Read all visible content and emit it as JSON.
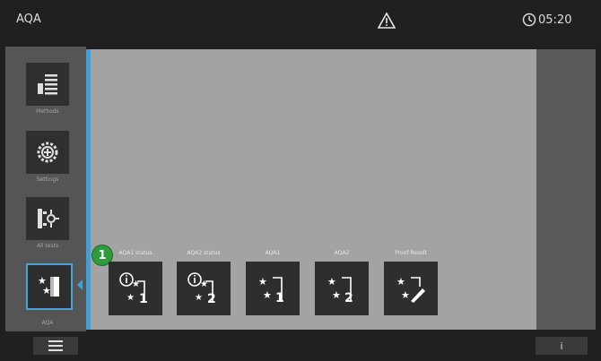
{
  "header": {
    "title": "AQA",
    "time": "05:20"
  },
  "sidebar": {
    "items": [
      {
        "label": "Methods",
        "icon": "methods-icon"
      },
      {
        "label": "Settings",
        "icon": "settings-icon"
      },
      {
        "label": "All tests",
        "icon": "all-tests-icon"
      },
      {
        "label": "AQA",
        "icon": "aqa-icon",
        "active": true
      }
    ]
  },
  "callout": {
    "number": "1"
  },
  "tiles": [
    {
      "label": "AQA1 status",
      "icon": "aqa1-status-icon"
    },
    {
      "label": "AQA2 status",
      "icon": "aqa2-status-icon"
    },
    {
      "label": "AQA1",
      "icon": "aqa1-icon"
    },
    {
      "label": "AQA2",
      "icon": "aqa2-icon"
    },
    {
      "label": "Proof Resolt",
      "icon": "proof-result-icon"
    }
  ],
  "footer": {
    "info_label": "i"
  },
  "colors": {
    "accent": "#3f9fd6",
    "badge": "#2f9b3e",
    "panel": "#a3a3a3"
  }
}
